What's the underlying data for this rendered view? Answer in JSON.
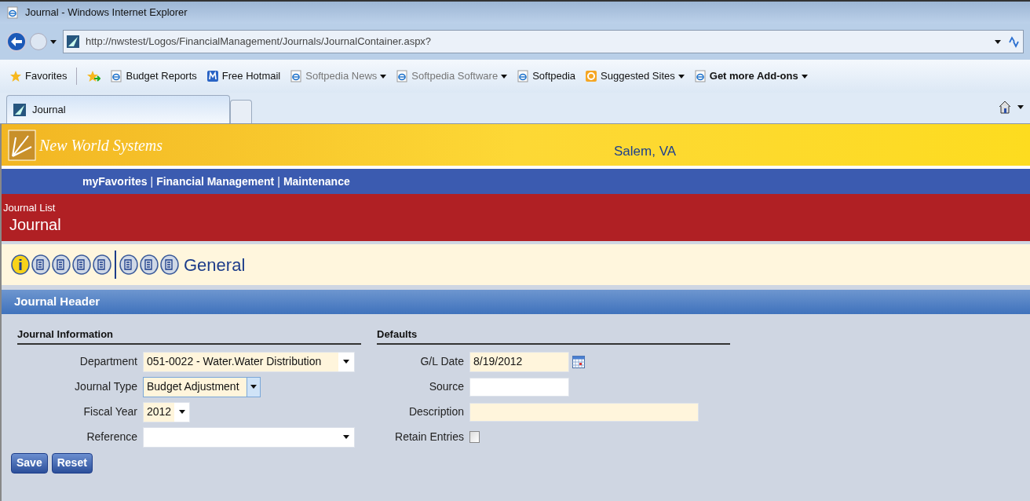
{
  "window": {
    "title": "Journal - Windows Internet Explorer"
  },
  "address_bar": {
    "url": "http://nwstest/Logos/FinancialManagement/Journals/JournalContainer.aspx?"
  },
  "favorites_bar": {
    "label": "Favorites",
    "items": [
      {
        "kind": "ie",
        "label": "Budget Reports",
        "dropdown": false,
        "dimmed": false,
        "bold": false
      },
      {
        "kind": "hotmail",
        "label": "Free Hotmail",
        "dropdown": false,
        "dimmed": false,
        "bold": false
      },
      {
        "kind": "ie",
        "label": "Softpedia News",
        "dropdown": true,
        "dimmed": true,
        "bold": false
      },
      {
        "kind": "ie",
        "label": "Softpedia Software",
        "dropdown": true,
        "dimmed": true,
        "bold": false
      },
      {
        "kind": "ie",
        "label": "Softpedia",
        "dropdown": false,
        "dimmed": false,
        "bold": false
      },
      {
        "kind": "suggested",
        "label": "Suggested Sites",
        "dropdown": true,
        "dimmed": false,
        "bold": false
      },
      {
        "kind": "ie",
        "label": "Get more Add-ons",
        "dropdown": true,
        "dimmed": false,
        "bold": true
      }
    ]
  },
  "tabs": [
    {
      "label": "Journal",
      "selected": true
    }
  ],
  "banner": {
    "logo": "New World Systems",
    "location": "Salem, VA"
  },
  "nav": {
    "items": [
      "myFavorites",
      "Financial Management",
      "Maintenance"
    ],
    "separator": "|"
  },
  "page_header": {
    "breadcrumb": "Journal List",
    "title": "Journal"
  },
  "toolbar": {
    "label": "General"
  },
  "section": {
    "title": "Journal Header"
  },
  "groups": [
    {
      "title": "Journal Information",
      "fields": [
        {
          "kind": "select",
          "label": "Department",
          "value": "051-0022 - Water.Water Distribution",
          "required": true,
          "focused": false
        },
        {
          "kind": "select",
          "label": "Journal Type",
          "value": "Budget Adjustment",
          "required": true,
          "focused": true
        },
        {
          "kind": "select",
          "label": "Fiscal Year",
          "value": "2012",
          "required": true,
          "focused": false
        },
        {
          "kind": "select",
          "label": "Reference",
          "required": false,
          "focused": false
        }
      ]
    },
    {
      "title": "Defaults",
      "fields": [
        {
          "kind": "date",
          "label": "G/L Date",
          "value": "8/19/2012",
          "required": true
        },
        {
          "kind": "text",
          "label": "Source",
          "required": false
        },
        {
          "kind": "text",
          "label": "Description",
          "required": true
        },
        {
          "kind": "checkbox",
          "label": "Retain Entries",
          "checked": false
        }
      ]
    }
  ],
  "buttons": [
    "Save",
    "Reset"
  ]
}
